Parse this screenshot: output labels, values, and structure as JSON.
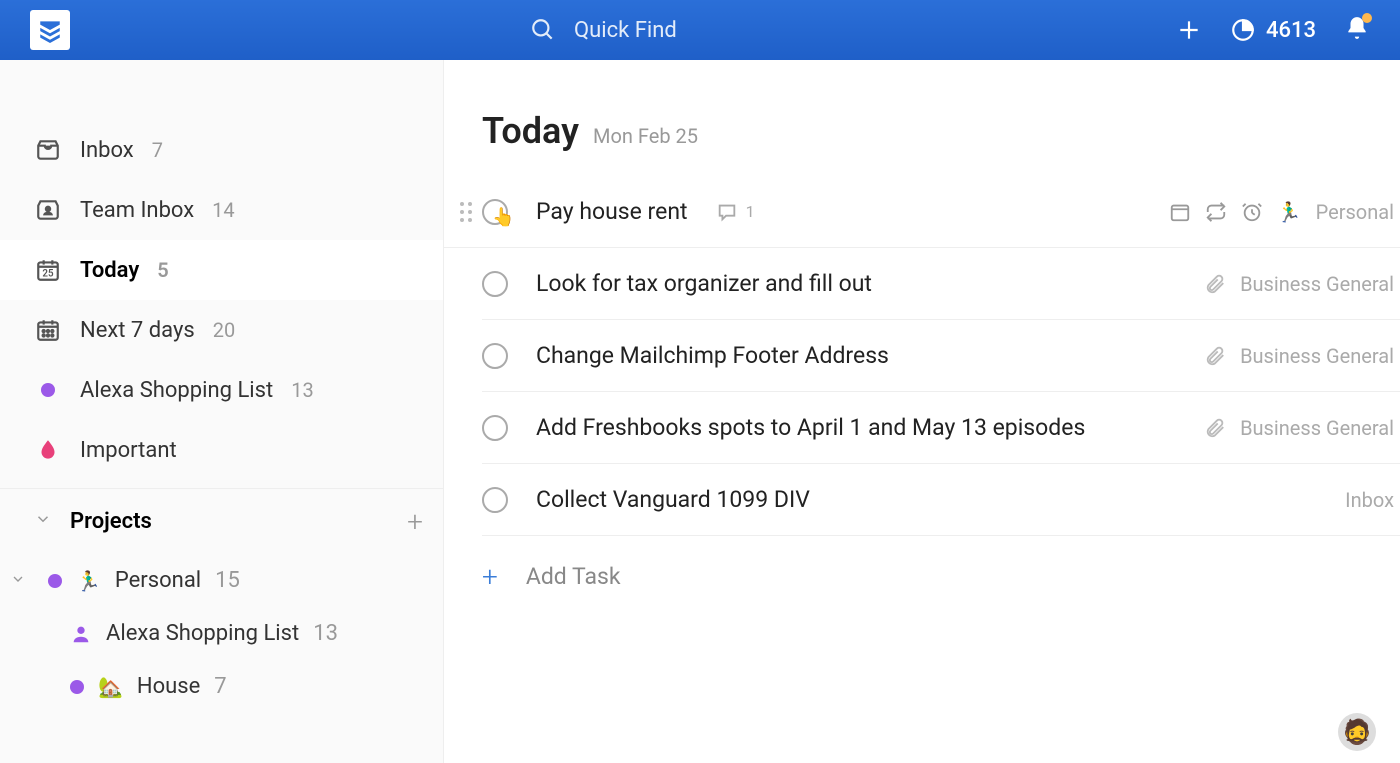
{
  "header": {
    "search_placeholder": "Quick Find",
    "karma": "4613"
  },
  "sidebar": {
    "items": [
      {
        "label": "Inbox",
        "count": "7"
      },
      {
        "label": "Team Inbox",
        "count": "14"
      },
      {
        "label": "Today",
        "count": "5"
      },
      {
        "label": "Next 7 days",
        "count": "20"
      },
      {
        "label": "Alexa Shopping List",
        "count": "13"
      },
      {
        "label": "Important",
        "count": ""
      }
    ],
    "projects_label": "Projects",
    "projects": [
      {
        "label": "Personal",
        "count": "15"
      },
      {
        "label": "Alexa Shopping List",
        "count": "13"
      },
      {
        "label": "House",
        "count": "7"
      }
    ]
  },
  "main": {
    "title": "Today",
    "subtitle": "Mon Feb 25",
    "tasks": [
      {
        "title": "Pay house rent",
        "comments": "1",
        "project": "Personal",
        "hover": true
      },
      {
        "title": "Look for tax organizer and fill out",
        "project": "Business General"
      },
      {
        "title": "Change Mailchimp Footer Address",
        "project": "Business General"
      },
      {
        "title": "Add Freshbooks spots to April 1 and May 13 episodes",
        "project": "Business General"
      },
      {
        "title": "Collect Vanguard 1099 DIV",
        "project": "Inbox"
      }
    ],
    "add_task": "Add Task"
  }
}
